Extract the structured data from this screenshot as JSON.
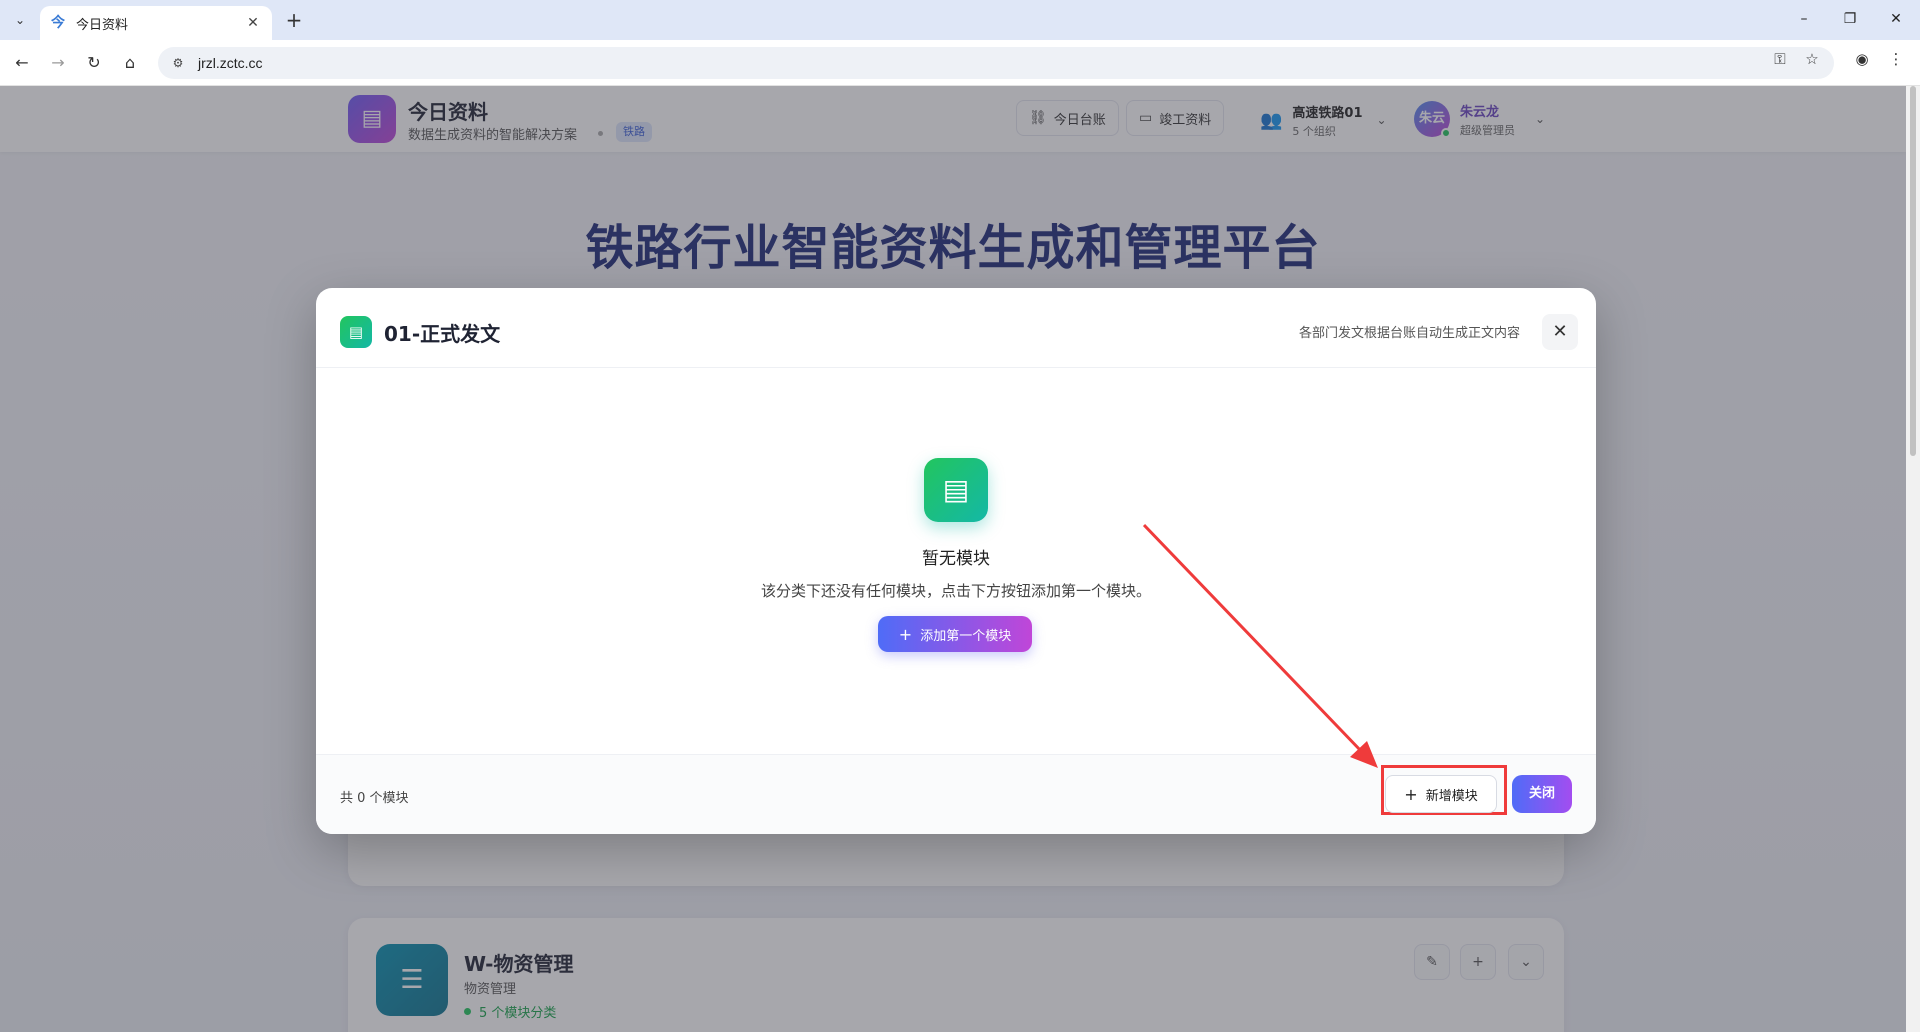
{
  "browser": {
    "tab_title": "今日资料",
    "url": "jrzl.zctc.cc"
  },
  "header": {
    "brand_name": "今日资料",
    "brand_subtitle": "数据生成资料的智能解决方案",
    "brand_tag": "铁路",
    "nav_ledger": "今日台账",
    "nav_completion": "竣工资料",
    "org_name": "高速铁路01",
    "org_count": "5 个组织",
    "user_avatar": "朱云",
    "user_name": "朱云龙",
    "user_role": "超级管理员"
  },
  "hero": {
    "title": "铁路行业智能资料生成和管理平台"
  },
  "modal": {
    "title": "01-正式发文",
    "description": "各部门发文根据台账自动生成正文内容",
    "empty_title": "暂无模块",
    "empty_desc": "该分类下还没有任何模块，点击下方按钮添加第一个模块。",
    "add_first_label": "添加第一个模块",
    "count_label": "共 0 个模块",
    "new_module_label": "新增模块",
    "close_label": "关闭"
  },
  "category_card": {
    "title": "W-物资管理",
    "subtitle": "物资管理",
    "count": "5 个模块分类"
  },
  "colors": {
    "brand_gradient_start": "#6d5cf6",
    "brand_gradient_end": "#c045d6",
    "accent_green": "#22c55e",
    "highlight_red": "#ef3b3b"
  },
  "icons": {
    "modal_icon": "document-icon",
    "close": "close-icon",
    "empty": "document-icon",
    "category": "list-search-icon"
  }
}
